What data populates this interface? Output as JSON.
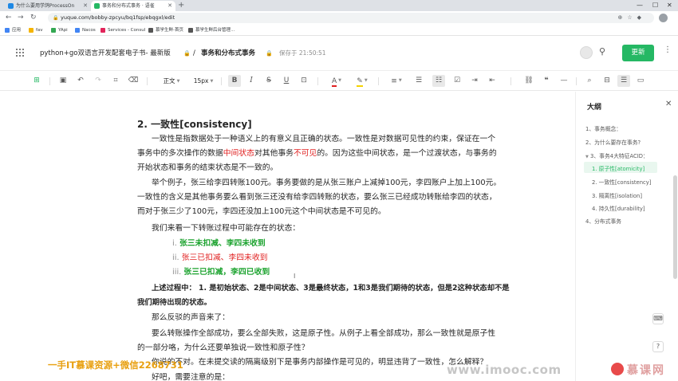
{
  "browser": {
    "tabs": [
      {
        "label": "为什么要用学鸽ProcessOn",
        "color": "#1e88e5",
        "active": false
      },
      {
        "label": "事务和分布式事务 · 语雀",
        "color": "#25b864",
        "active": true
      }
    ],
    "url": "yuque.com/bobby-zpcyu/bq1fsp/ebqgxl/edit",
    "bookmarks": [
      {
        "label": "应用",
        "color": "#4285f4"
      },
      {
        "label": "fav",
        "color": "#f5b400"
      },
      {
        "label": "YApi",
        "color": "#34a853"
      },
      {
        "label": "Nacos",
        "color": "#4285f4"
      },
      {
        "label": "Services - Consul",
        "color": "#e2245b"
      },
      {
        "label": "慕学生鲜-首页",
        "color": "#555555"
      },
      {
        "label": "慕学生鲜后台管理...",
        "color": "#555555"
      }
    ]
  },
  "header": {
    "book": "python+go双语言开发配套电子书- 最新版",
    "separator": "/",
    "doc_title": "事务和分布式事务",
    "saved": "保存于 21:50:51",
    "update_label": "更新"
  },
  "toolbar": {
    "style": "正文",
    "font_size": "15px"
  },
  "doc": {
    "heading": "2. 一致性[consistency]",
    "p1": {
      "l1": "一致性是指数据处于一种语义上的有意义且正确的状态。一致性是对数据可见性的约束，保证在一个",
      "l2a": "事务中的多次操作的数据",
      "l2b": "中间状态",
      "l2c": "对其他事务",
      "l2d": "不可见",
      "l2e": "的。因为这些中间状态，是一个过渡状态，与事务的",
      "l3": "开始状态和事务的结束状态是不一致的。"
    },
    "p2": {
      "l1": "举个例子，张三给李四转账100元。事务要做的是从张三账户上减掉100元，李四账户上加上100元。",
      "l2": "一致性的含义是其他事务要么看到张三还没有给李四转账的状态，要么张三已经成功转账给李四的状态，",
      "l3": "而对于张三少了100元，李四还没加上100元这个中间状态是不可见的。"
    },
    "p3": "我们来看一下转账过程中可能存在的状态：",
    "states": [
      {
        "marker": "i.",
        "text": "张三未扣减、李四未收到"
      },
      {
        "marker": "ii.",
        "text": "张三已扣减、李四未收到"
      },
      {
        "marker": "iii.",
        "text": "张三已扣减，李四已收到"
      }
    ],
    "p4": {
      "l1": "上述过程中： 1. 是初始状态、2是中间状态、3是最终状态，1和3是我们期待的状态，但是2这种状态却不是",
      "l2": "我们期待出现的状态。"
    },
    "p5": "那么反驳的声音来了：",
    "p6": {
      "l1": "要么转账操作全部成功，要么全部失败，这是原子性。从例子上看全部成功，那么一致性就是原子性",
      "l2": "的一部分咯，为什么还要单独说一致性和原子性？"
    },
    "p7": "你说的不对。在未提交读的隔离级别下是事务内部操作是可见的，明显违背了一致性，怎么解释？",
    "p8": "好吧，需要注意的是："
  },
  "outline": {
    "title": "大纲",
    "items": [
      {
        "label": "1、事务概念：",
        "level": 1
      },
      {
        "label": "2、为什么要存在事务?",
        "level": 1
      },
      {
        "label": "3、事务4大特征ACID：",
        "level": 1
      },
      {
        "label": "1. 原子性[atomicity]",
        "level": 2
      },
      {
        "label": "2. 一致性[consistency]",
        "level": 2
      },
      {
        "label": "3. 隔离性[isolation]",
        "level": 2
      },
      {
        "label": "4. 持久性[durability]",
        "level": 2
      },
      {
        "label": "4、分布式事务",
        "level": 1
      }
    ]
  },
  "watermark": {
    "left": "一手IT慕课资源+微信2268731",
    "site": "www.imooc.com",
    "brand": "慕课网"
  }
}
